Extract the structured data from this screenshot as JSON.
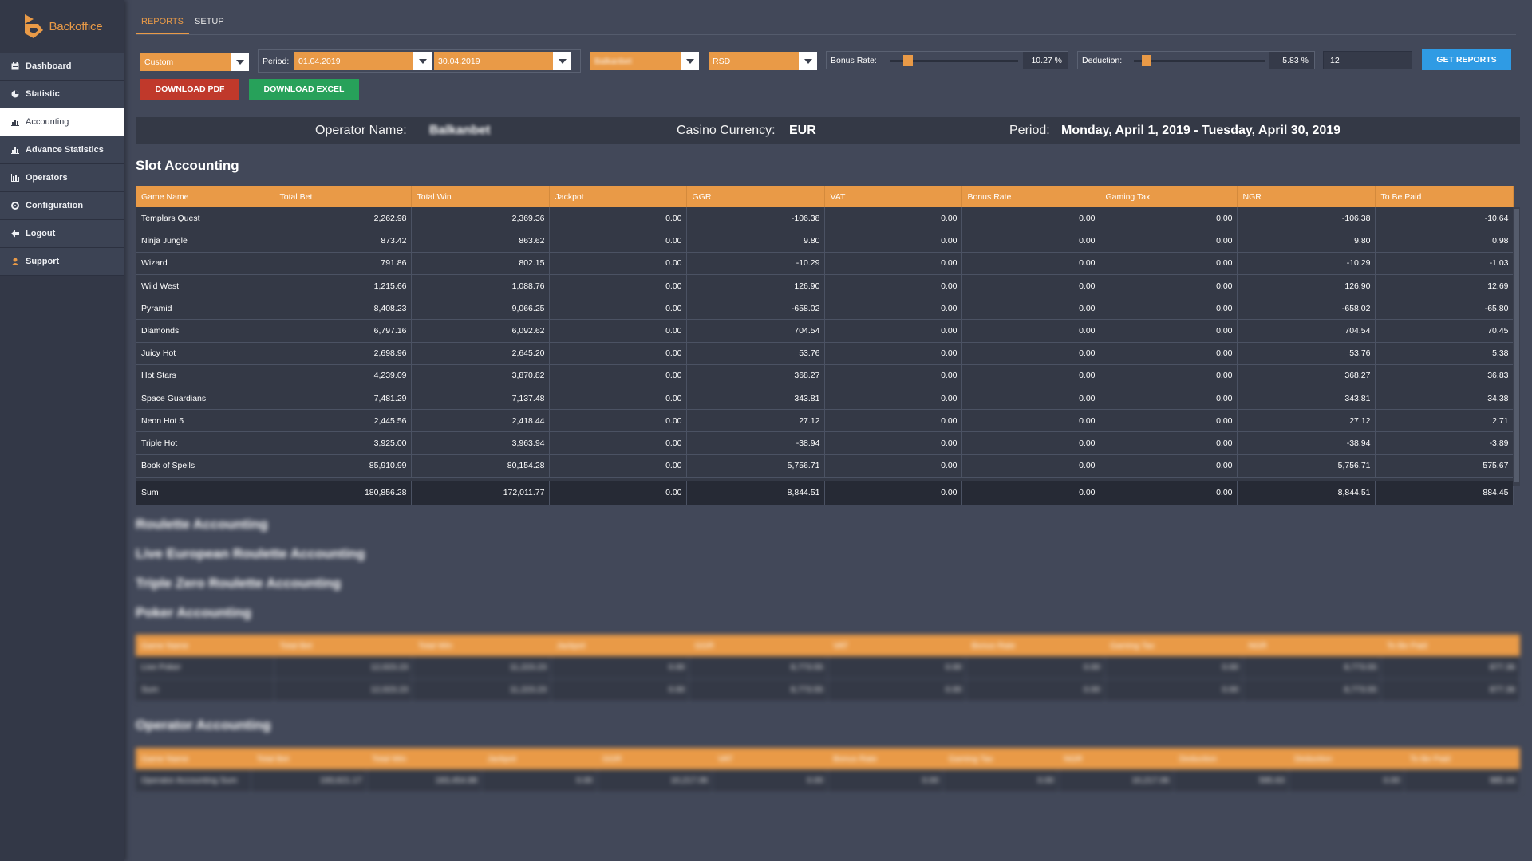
{
  "app": {
    "logo_text": "Backoffice",
    "accent": "#e99a47"
  },
  "sidebar": {
    "items": [
      {
        "label": "Dashboard",
        "icon": "calendar-icon"
      },
      {
        "label": "Statistic",
        "icon": "pie-chart-icon"
      },
      {
        "label": "Accounting",
        "icon": "bar-chart-icon",
        "active": true
      },
      {
        "label": "Advance Statistics",
        "icon": "bar-chart-icon"
      },
      {
        "label": "Operators",
        "icon": "line-chart-icon"
      },
      {
        "label": "Configuration",
        "icon": "gear-icon"
      },
      {
        "label": "Logout",
        "icon": "arrow-left-icon"
      },
      {
        "label": "Support",
        "icon": "user-icon"
      }
    ]
  },
  "tabs": [
    {
      "label": "REPORTS",
      "active": true
    },
    {
      "label": "SETUP"
    }
  ],
  "filters": {
    "range_type": "Custom",
    "period_label": "Period:",
    "date_from": "01.04.2019",
    "date_to": "30.04.2019",
    "operator_select": "Balkanbet",
    "currency_select": "RSD",
    "bonus_rate_label": "Bonus Rate:",
    "bonus_rate_value": "10.27 %",
    "bonus_rate_level_percent": 10.27,
    "deduction_label": "Deduction:",
    "deduction_value": "5.83 %",
    "deduction_level_percent": 5.83,
    "number_value": "12",
    "get_reports": "GET REPORTS",
    "download_pdf": "DOWNLOAD PDF",
    "download_excel": "DOWNLOAD EXCEL"
  },
  "info": {
    "operator_label": "Operator Name:",
    "operator_value": "Balkanbet",
    "currency_label": "Casino Currency:",
    "currency_value": "EUR",
    "period_label": "Period:",
    "period_value": "Monday, April 1, 2019 - Tuesday, April 30, 2019"
  },
  "slot_accounting": {
    "title": "Slot Accounting",
    "columns": [
      "Game Name",
      "Total Bet",
      "Total Win",
      "Jackpot",
      "GGR",
      "VAT",
      "Bonus Rate",
      "Gaming Tax",
      "NGR",
      "To Be Paid"
    ],
    "rows": [
      [
        "Templars Quest",
        "2,262.98",
        "2,369.36",
        "0.00",
        "-106.38",
        "0.00",
        "0.00",
        "0.00",
        "-106.38",
        "-10.64"
      ],
      [
        "Ninja Jungle",
        "873.42",
        "863.62",
        "0.00",
        "9.80",
        "0.00",
        "0.00",
        "0.00",
        "9.80",
        "0.98"
      ],
      [
        "Wizard",
        "791.86",
        "802.15",
        "0.00",
        "-10.29",
        "0.00",
        "0.00",
        "0.00",
        "-10.29",
        "-1.03"
      ],
      [
        "Wild West",
        "1,215.66",
        "1,088.76",
        "0.00",
        "126.90",
        "0.00",
        "0.00",
        "0.00",
        "126.90",
        "12.69"
      ],
      [
        "Pyramid",
        "8,408.23",
        "9,066.25",
        "0.00",
        "-658.02",
        "0.00",
        "0.00",
        "0.00",
        "-658.02",
        "-65.80"
      ],
      [
        "Diamonds",
        "6,797.16",
        "6,092.62",
        "0.00",
        "704.54",
        "0.00",
        "0.00",
        "0.00",
        "704.54",
        "70.45"
      ],
      [
        "Juicy Hot",
        "2,698.96",
        "2,645.20",
        "0.00",
        "53.76",
        "0.00",
        "0.00",
        "0.00",
        "53.76",
        "5.38"
      ],
      [
        "Hot Stars",
        "4,239.09",
        "3,870.82",
        "0.00",
        "368.27",
        "0.00",
        "0.00",
        "0.00",
        "368.27",
        "36.83"
      ],
      [
        "Space Guardians",
        "7,481.29",
        "7,137.48",
        "0.00",
        "343.81",
        "0.00",
        "0.00",
        "0.00",
        "343.81",
        "34.38"
      ],
      [
        "Neon Hot 5",
        "2,445.56",
        "2,418.44",
        "0.00",
        "27.12",
        "0.00",
        "0.00",
        "0.00",
        "27.12",
        "2.71"
      ],
      [
        "Triple Hot",
        "3,925.00",
        "3,963.94",
        "0.00",
        "-38.94",
        "0.00",
        "0.00",
        "0.00",
        "-38.94",
        "-3.89"
      ],
      [
        "Book of Spells",
        "85,910.99",
        "80,154.28",
        "0.00",
        "5,756.71",
        "0.00",
        "0.00",
        "0.00",
        "5,756.71",
        "575.67"
      ]
    ],
    "sum": [
      "Sum",
      "180,856.28",
      "172,011.77",
      "0.00",
      "8,844.51",
      "0.00",
      "0.00",
      "0.00",
      "8,844.51",
      "884.45"
    ]
  },
  "blurred_sections": {
    "titles": [
      "Roulette Accounting",
      "Live European Roulette Accounting",
      "Triple Zero Roulette Accounting",
      "Poker Accounting"
    ],
    "poker_columns": [
      "Game Name",
      "Total Bet",
      "Total Win",
      "Jackpot",
      "GGR",
      "VAT",
      "Bonus Rate",
      "Gaming Tax",
      "NGR",
      "To Be Paid"
    ],
    "poker_rows": [
      [
        "Live Poker",
        "12,023.23",
        "11,223.23",
        "0.00",
        "8,773.55",
        "0.00",
        "0.00",
        "0.00",
        "8,773.55",
        "877.36"
      ],
      [
        "Sum",
        "12,023.23",
        "11,223.23",
        "0.00",
        "8,773.55",
        "0.00",
        "0.00",
        "0.00",
        "8,773.55",
        "877.36"
      ]
    ],
    "operator_title": "Operator Accounting",
    "operator_columns": [
      "Game Name",
      "Total Bet",
      "Total Win",
      "Jackpot",
      "GGR",
      "VAT",
      "Bonus Rate",
      "Gaming Tax",
      "NGR",
      "Deduction",
      "Deduction",
      "To Be Paid"
    ],
    "operator_rows": [
      [
        "Operator Accounting Sum",
        "193,621.17",
        "183,454.88",
        "0.00",
        "10,217.06",
        "0.00",
        "0.00",
        "0.00",
        "10,217.06",
        "595.63",
        "0.00",
        "985.44"
      ]
    ]
  }
}
